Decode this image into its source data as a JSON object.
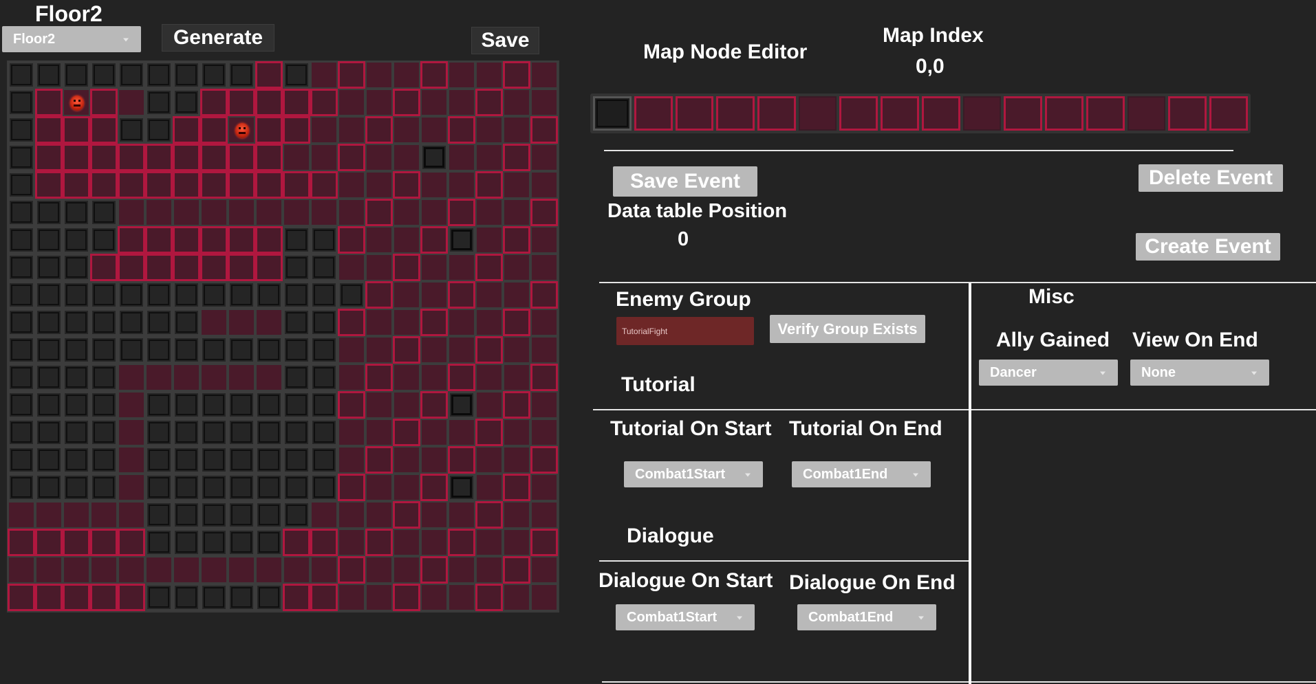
{
  "toolbar": {
    "floor_title": "Floor2",
    "floor_select": "Floor2",
    "generate_label": "Generate",
    "save_label": "Save"
  },
  "map": {
    "size": 20,
    "rows": [
      "eeeeeeeeebeBBBBBBBBB",
      "ebXbreebbbbBBBBBBBBB",
      "ebbbeebbXbbBBBBBBBBB",
      "ebbbbbbbbbBBBBBsBBBB",
      "ebbbbbbbbbbBBBBBBBBB",
      "eeeerrrrrrrBBBBBBBBB",
      "eeeebbbbbbeeBBBBsBBB",
      "eeebbbbbbbeeBBBBBBBB",
      "eeeeeeeeeeeeeBBBBBBB",
      "eeeeeeerrreeBBBBBBBB",
      "eeeeeeeeeeeeBBBBBBBB",
      "eeeerrrrrreeBBBBBBBB",
      "eeeereeeeeeeBBBBsBBB",
      "eeeereeeeeeeBBBBBBBB",
      "eeeereeeeeeeBBBBBBBB",
      "eeeereeeeeeeBBBBsBBB",
      "rrrrreeeeeerBBBBBBBB",
      "bbbbbeeeeebbBBBBBBBB",
      "rrrrrrrrrrrrBBBBBBBB",
      "bbbbbeeeeebbBBBBBBBB"
    ]
  },
  "editor": {
    "title": "Map Node Editor",
    "map_index_label": "Map Index",
    "map_index_value": "0,0",
    "node_strip": [
      "e",
      "b",
      "b",
      "b",
      "b",
      "r",
      "b",
      "b",
      "b",
      "r",
      "b",
      "b",
      "b",
      "r",
      "b",
      "b"
    ],
    "save_event_label": "Save Event",
    "delete_event_label": "Delete Event",
    "create_event_label": "Create Event",
    "data_table_label": "Data table Position",
    "data_table_value": "0"
  },
  "enemy_group": {
    "label": "Enemy Group",
    "value": "TutorialFight",
    "verify_label": "Verify Group Exists"
  },
  "misc": {
    "label": "Misc",
    "ally_gained_label": "Ally Gained",
    "ally_gained_value": "Dancer",
    "view_on_end_label": "View On End",
    "view_on_end_value": "None"
  },
  "tutorial": {
    "label": "Tutorial",
    "on_start_label": "Tutorial On Start",
    "on_start_value": "Combat1Start",
    "on_end_label": "Tutorial On End",
    "on_end_value": "Combat1End"
  },
  "dialogue": {
    "label": "Dialogue",
    "on_start_label": "Dialogue On Start",
    "on_start_value": "Combat1Start",
    "on_end_label": "Dialogue On End",
    "on_end_value": "Combat1End"
  }
}
